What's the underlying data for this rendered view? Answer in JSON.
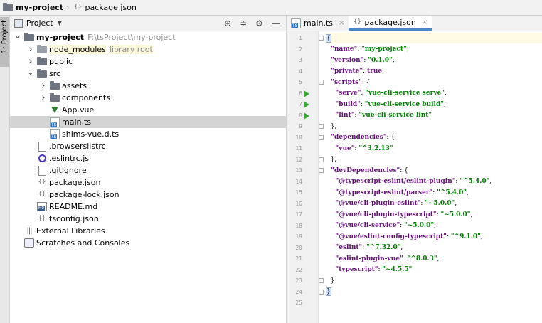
{
  "breadcrumb": {
    "project": "my-project",
    "file": "package.json"
  },
  "sidebar": {
    "tab_label": "1: Project"
  },
  "project_panel": {
    "title": "Project",
    "tree": [
      {
        "depth": 0,
        "arrow": "down",
        "icon": "folder",
        "label": "my-project",
        "bold": true,
        "muted": "F:\\tsProject\\my-project"
      },
      {
        "depth": 1,
        "arrow": "right",
        "icon": "folder-light",
        "label": "node_modules",
        "muted": "library root",
        "highlight": true
      },
      {
        "depth": 1,
        "arrow": "right",
        "icon": "folder",
        "label": "public"
      },
      {
        "depth": 1,
        "arrow": "down",
        "icon": "folder",
        "label": "src"
      },
      {
        "depth": 2,
        "arrow": "right",
        "icon": "folder",
        "label": "assets"
      },
      {
        "depth": 2,
        "arrow": "right",
        "icon": "folder",
        "label": "components"
      },
      {
        "depth": 2,
        "arrow": "",
        "icon": "vue",
        "label": "App.vue"
      },
      {
        "depth": 2,
        "arrow": "",
        "icon": "ts",
        "label": "main.ts",
        "selected": true
      },
      {
        "depth": 2,
        "arrow": "",
        "icon": "ts",
        "label": "shims-vue.d.ts"
      },
      {
        "depth": 1,
        "arrow": "",
        "icon": "file",
        "label": ".browserslistrc"
      },
      {
        "depth": 1,
        "arrow": "",
        "icon": "eslint",
        "label": ".eslintrc.js"
      },
      {
        "depth": 1,
        "arrow": "",
        "icon": "file",
        "label": ".gitignore"
      },
      {
        "depth": 1,
        "arrow": "",
        "icon": "json",
        "label": "package.json"
      },
      {
        "depth": 1,
        "arrow": "",
        "icon": "json",
        "label": "package-lock.json"
      },
      {
        "depth": 1,
        "arrow": "",
        "icon": "md",
        "label": "README.md"
      },
      {
        "depth": 1,
        "arrow": "",
        "icon": "json",
        "label": "tsconfig.json"
      },
      {
        "depth": 0,
        "arrow": "",
        "icon": "library",
        "label": "External Libraries"
      },
      {
        "depth": 0,
        "arrow": "",
        "icon": "scratch",
        "label": "Scratches and Consoles"
      }
    ]
  },
  "editor": {
    "tabs": [
      {
        "label": "main.ts",
        "active": false,
        "icon": "ts"
      },
      {
        "label": "package.json",
        "active": true,
        "icon": "json"
      }
    ],
    "lines": [
      {
        "n": "1",
        "fold": true,
        "tokens": [
          {
            "t": "{",
            "c": "p"
          }
        ]
      },
      {
        "n": "2",
        "tokens": [
          {
            "t": "  \"name\"",
            "c": "k"
          },
          {
            "t": ": ",
            "c": "p"
          },
          {
            "t": "\"my-project\"",
            "c": "s"
          },
          {
            "t": ",",
            "c": "p"
          }
        ]
      },
      {
        "n": "3",
        "tokens": [
          {
            "t": "  \"version\"",
            "c": "k"
          },
          {
            "t": ": ",
            "c": "p"
          },
          {
            "t": "\"0.1.0\"",
            "c": "s"
          },
          {
            "t": ",",
            "c": "p"
          }
        ]
      },
      {
        "n": "4",
        "tokens": [
          {
            "t": "  \"private\"",
            "c": "k"
          },
          {
            "t": ": ",
            "c": "p"
          },
          {
            "t": "true",
            "c": "k"
          },
          {
            "t": ",",
            "c": "p"
          }
        ]
      },
      {
        "n": "5",
        "fold": true,
        "tokens": [
          {
            "t": "  \"scripts\"",
            "c": "k"
          },
          {
            "t": ": {",
            "c": "p"
          }
        ]
      },
      {
        "n": "6",
        "run": true,
        "tokens": [
          {
            "t": "    \"serve\"",
            "c": "k"
          },
          {
            "t": ": ",
            "c": "p"
          },
          {
            "t": "\"vue-cli-service serve\"",
            "c": "s"
          },
          {
            "t": ",",
            "c": "p"
          }
        ]
      },
      {
        "n": "7",
        "run": true,
        "tokens": [
          {
            "t": "    \"build\"",
            "c": "k"
          },
          {
            "t": ": ",
            "c": "p"
          },
          {
            "t": "\"vue-cli-service build\"",
            "c": "s"
          },
          {
            "t": ",",
            "c": "p"
          }
        ]
      },
      {
        "n": "8",
        "run": true,
        "tokens": [
          {
            "t": "    \"lint\"",
            "c": "k"
          },
          {
            "t": ": ",
            "c": "p"
          },
          {
            "t": "\"vue-cli-service lint\"",
            "c": "s"
          }
        ]
      },
      {
        "n": "9",
        "fold": true,
        "tokens": [
          {
            "t": "  },",
            "c": "p"
          }
        ]
      },
      {
        "n": "10",
        "fold": true,
        "tokens": [
          {
            "t": "  \"dependencies\"",
            "c": "k"
          },
          {
            "t": ": {",
            "c": "p"
          }
        ]
      },
      {
        "n": "11",
        "tokens": [
          {
            "t": "    \"vue\"",
            "c": "k"
          },
          {
            "t": ": ",
            "c": "p"
          },
          {
            "t": "\"^3.2.13\"",
            "c": "s"
          }
        ]
      },
      {
        "n": "12",
        "fold": true,
        "tokens": [
          {
            "t": "  },",
            "c": "p"
          }
        ]
      },
      {
        "n": "13",
        "fold": true,
        "tokens": [
          {
            "t": "  \"devDependencies\"",
            "c": "k"
          },
          {
            "t": ": {",
            "c": "p"
          }
        ]
      },
      {
        "n": "14",
        "tokens": [
          {
            "t": "    \"@typescript-eslint/eslint-plugin\"",
            "c": "k"
          },
          {
            "t": ": ",
            "c": "p"
          },
          {
            "t": "\"^5.4.0\"",
            "c": "s"
          },
          {
            "t": ",",
            "c": "p"
          }
        ]
      },
      {
        "n": "15",
        "tokens": [
          {
            "t": "    \"@typescript-eslint/parser\"",
            "c": "k"
          },
          {
            "t": ": ",
            "c": "p"
          },
          {
            "t": "\"^5.4.0\"",
            "c": "s"
          },
          {
            "t": ",",
            "c": "p"
          }
        ]
      },
      {
        "n": "16",
        "tokens": [
          {
            "t": "    \"@vue/cli-plugin-eslint\"",
            "c": "k"
          },
          {
            "t": ": ",
            "c": "p"
          },
          {
            "t": "\"~5.0.0\"",
            "c": "s"
          },
          {
            "t": ",",
            "c": "p"
          }
        ]
      },
      {
        "n": "17",
        "tokens": [
          {
            "t": "    \"@vue/cli-plugin-typescript\"",
            "c": "k"
          },
          {
            "t": ": ",
            "c": "p"
          },
          {
            "t": "\"~5.0.0\"",
            "c": "s"
          },
          {
            "t": ",",
            "c": "p"
          }
        ]
      },
      {
        "n": "18",
        "tokens": [
          {
            "t": "    \"@vue/cli-service\"",
            "c": "k"
          },
          {
            "t": ": ",
            "c": "p"
          },
          {
            "t": "\"~5.0.0\"",
            "c": "s"
          },
          {
            "t": ",",
            "c": "p"
          }
        ]
      },
      {
        "n": "19",
        "tokens": [
          {
            "t": "    \"@vue/eslint-config-typescript\"",
            "c": "k"
          },
          {
            "t": ": ",
            "c": "p"
          },
          {
            "t": "\"^9.1.0\"",
            "c": "s"
          },
          {
            "t": ",",
            "c": "p"
          }
        ]
      },
      {
        "n": "20",
        "tokens": [
          {
            "t": "    \"eslint\"",
            "c": "k"
          },
          {
            "t": ": ",
            "c": "p"
          },
          {
            "t": "\"^7.32.0\"",
            "c": "s"
          },
          {
            "t": ",",
            "c": "p"
          }
        ]
      },
      {
        "n": "21",
        "tokens": [
          {
            "t": "    \"eslint-plugin-vue\"",
            "c": "k"
          },
          {
            "t": ": ",
            "c": "p"
          },
          {
            "t": "\"^8.0.3\"",
            "c": "s"
          },
          {
            "t": ",",
            "c": "p"
          }
        ]
      },
      {
        "n": "22",
        "tokens": [
          {
            "t": "    \"typescript\"",
            "c": "k"
          },
          {
            "t": ": ",
            "c": "p"
          },
          {
            "t": "\"~4.5.5\"",
            "c": "s"
          }
        ]
      },
      {
        "n": "23",
        "fold": true,
        "tokens": [
          {
            "t": "  }",
            "c": "p"
          }
        ]
      },
      {
        "n": "24",
        "fold": true,
        "tokens": [
          {
            "t": "}",
            "c": "p"
          }
        ]
      },
      {
        "n": "25",
        "tokens": []
      }
    ]
  }
}
